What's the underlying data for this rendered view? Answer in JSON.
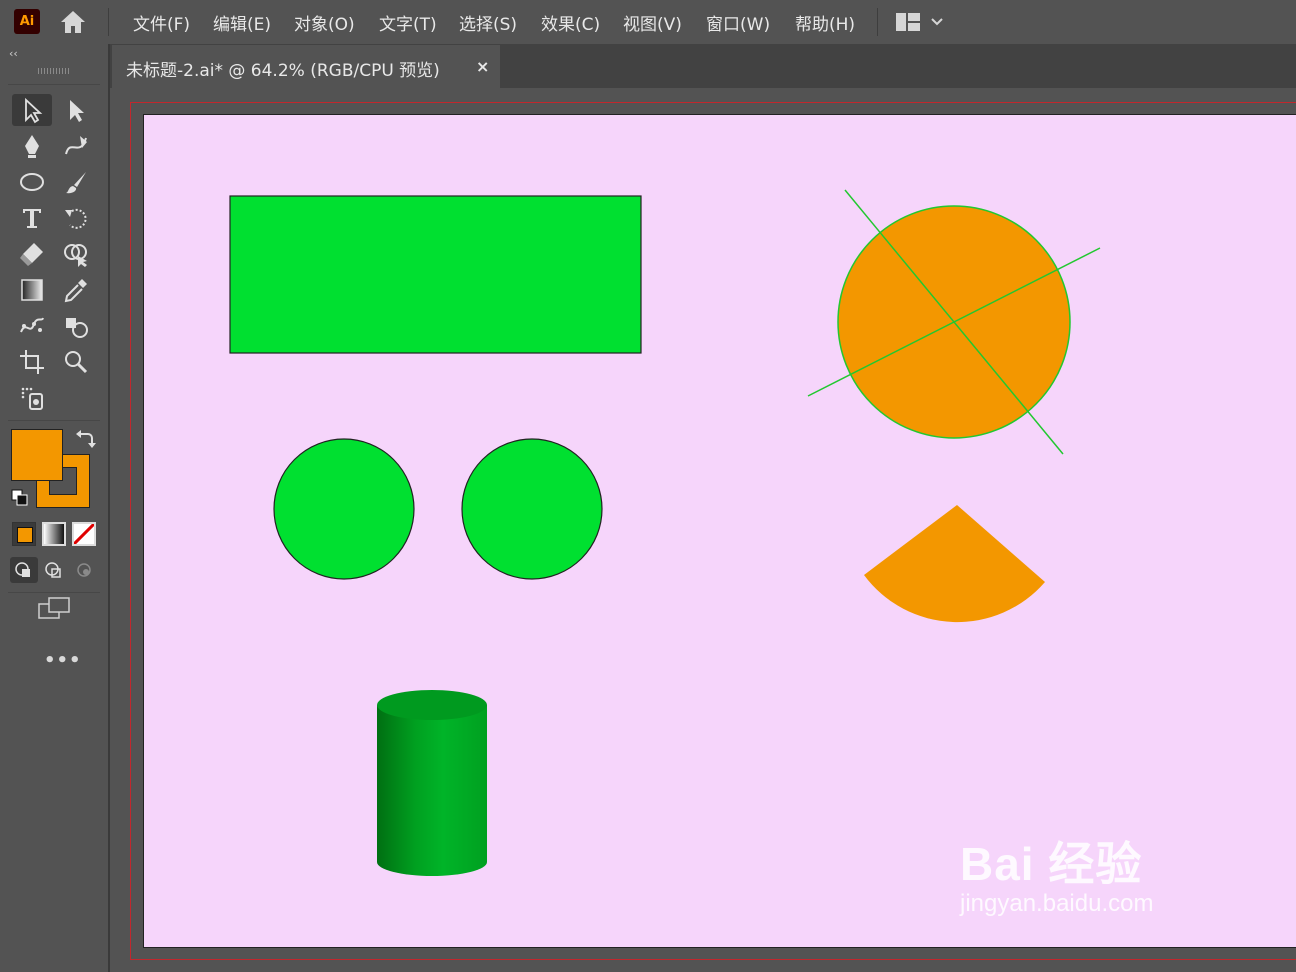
{
  "app": {
    "logo": "Ai"
  },
  "menu": [
    "文件(F)",
    "编辑(E)",
    "对象(O)",
    "文字(T)",
    "选择(S)",
    "效果(C)",
    "视图(V)",
    "窗口(W)",
    "帮助(H)"
  ],
  "toolbar": {
    "collapse": "‹‹",
    "more": "•••"
  },
  "document": {
    "tab_title": "未标题-2.ai* @ 64.2% (RGB/CPU 预览)",
    "close": "×"
  },
  "colors": {
    "fill": "#f39700",
    "artboard": "#f6d5fb",
    "green": "#00e030",
    "cylinder": "#00a020",
    "line": "#22c830"
  },
  "watermark": {
    "brand": "Bai 经验",
    "url": "jingyan.baidu.com"
  }
}
